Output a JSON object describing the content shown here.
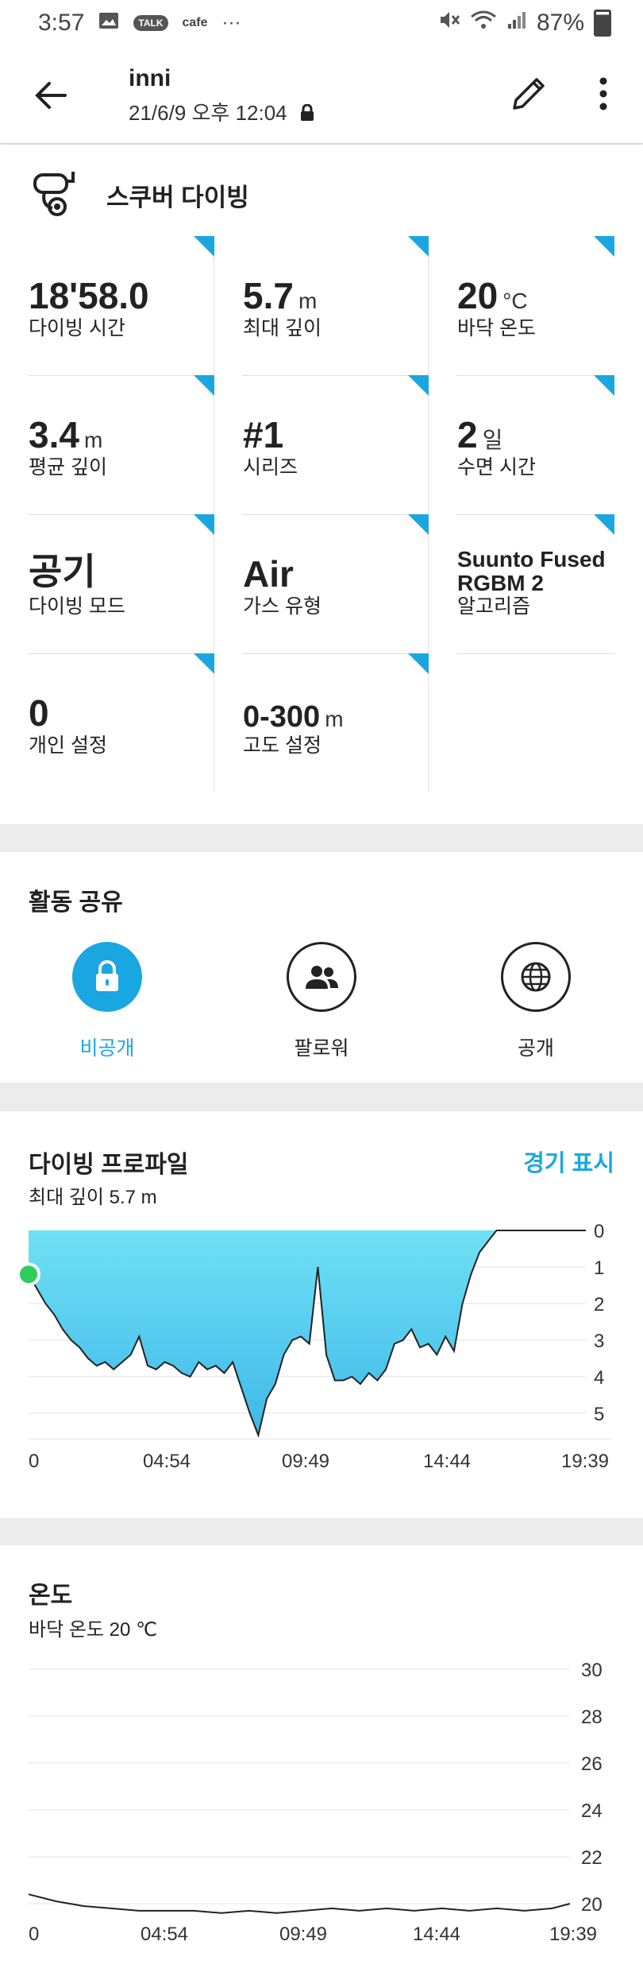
{
  "status": {
    "time": "3:57",
    "battery": "87%",
    "app_labels": [
      "TALK",
      "cafe"
    ],
    "more": "···"
  },
  "header": {
    "title": "inni",
    "subtitle": "21/6/9 오후 12:04"
  },
  "sport": {
    "label": "스쿠버 다이빙",
    "icon": "scuba-mask-icon"
  },
  "stats": [
    {
      "value": "18'58.0",
      "unit": "",
      "label": "다이빙 시간"
    },
    {
      "value": "5.7",
      "unit": "m",
      "label": "최대 깊이"
    },
    {
      "value": "20",
      "unit": "°C",
      "label": "바닥 온도"
    },
    {
      "value": "3.4",
      "unit": "m",
      "label": "평균 깊이"
    },
    {
      "value": "#1",
      "unit": "",
      "label": "시리즈"
    },
    {
      "value": "2",
      "unit": "일",
      "label": "수면 시간"
    },
    {
      "value": "공기",
      "unit": "",
      "label": "다이빙 모드"
    },
    {
      "value": "Air",
      "unit": "",
      "label": "가스 유형"
    },
    {
      "value": "Suunto Fused RGBM 2",
      "unit": "",
      "label": "알고리즘"
    },
    {
      "value": "0",
      "unit": "",
      "label": "개인 설정"
    },
    {
      "value": "0-300",
      "unit": "m",
      "label": "고도 설정"
    }
  ],
  "share": {
    "title": "활동 공유",
    "options": [
      {
        "label": "비공개",
        "icon": "lock-icon",
        "selected": true
      },
      {
        "label": "팔로워",
        "icon": "followers-icon",
        "selected": false
      },
      {
        "label": "공개",
        "icon": "globe-icon",
        "selected": false
      }
    ]
  },
  "colors": {
    "accent": "#1aa7e1",
    "marker": "#2ecc5a",
    "area_top": "#6fe1f5",
    "area_bottom": "#3fb8e8"
  },
  "profile": {
    "title": "다이빙 프로파일",
    "subtitle": "최대 깊이 5.7 m",
    "link": "경기 표시",
    "chart_data": {
      "type": "area",
      "x_ticks": [
        "0",
        "04:54",
        "09:49",
        "14:44",
        "19:39"
      ],
      "y_ticks": [
        "0",
        "1",
        "2",
        "3",
        "4",
        "5"
      ],
      "ylim": [
        0,
        5.7
      ],
      "y_inverted": true,
      "x_minutes": [
        0,
        0.3,
        0.6,
        0.9,
        1.2,
        1.5,
        1.8,
        2.1,
        2.4,
        2.7,
        3.0,
        3.3,
        3.6,
        3.9,
        4.2,
        4.5,
        4.8,
        5.1,
        5.4,
        5.7,
        6.0,
        6.3,
        6.6,
        6.9,
        7.2,
        7.5,
        7.8,
        8.1,
        8.4,
        8.7,
        9.0,
        9.3,
        9.6,
        9.9,
        10.2,
        10.5,
        10.8,
        11.1,
        11.4,
        11.7,
        12.0,
        12.3,
        12.6,
        12.9,
        13.2,
        13.5,
        13.8,
        14.1,
        14.4,
        14.7,
        15.0,
        15.3,
        15.6,
        15.9,
        16.2,
        16.5,
        16.8,
        17.1,
        17.4,
        17.7,
        18.0,
        18.3,
        18.6,
        18.9,
        19.2,
        19.65
      ],
      "depth_m": [
        1.2,
        1.6,
        2.0,
        2.3,
        2.7,
        3.0,
        3.2,
        3.5,
        3.7,
        3.6,
        3.8,
        3.6,
        3.4,
        2.9,
        3.7,
        3.8,
        3.6,
        3.7,
        3.9,
        4.0,
        3.6,
        3.8,
        3.7,
        3.9,
        3.6,
        4.3,
        5.0,
        5.6,
        4.6,
        4.2,
        3.4,
        3.0,
        2.9,
        3.1,
        1.0,
        3.4,
        4.1,
        4.1,
        4.0,
        4.2,
        3.9,
        4.1,
        3.8,
        3.1,
        3.0,
        2.7,
        3.2,
        3.1,
        3.4,
        2.9,
        3.3,
        2.0,
        1.2,
        0.6,
        0.3,
        0.0,
        0.0,
        0.0,
        0.0,
        0.0,
        0.0,
        0.0,
        0.0,
        0.0,
        0.0,
        0.0
      ]
    }
  },
  "temperature": {
    "title": "온도",
    "subtitle": "바닥 온도 20 ℃",
    "chart_data": {
      "type": "line",
      "x_ticks": [
        "0",
        "04:54",
        "09:49",
        "14:44",
        "19:39"
      ],
      "y_ticks": [
        "30",
        "28",
        "26",
        "24",
        "22",
        "20"
      ],
      "ylim": [
        19.6,
        30
      ],
      "x_minutes": [
        0,
        1,
        2,
        3,
        4,
        5,
        6,
        7,
        8,
        9,
        10,
        11,
        12,
        13,
        14,
        15,
        16,
        17,
        18,
        19,
        19.65
      ],
      "temp_c": [
        20.4,
        20.1,
        19.9,
        19.8,
        19.7,
        19.7,
        19.7,
        19.6,
        19.7,
        19.6,
        19.7,
        19.8,
        19.7,
        19.8,
        19.7,
        19.8,
        19.7,
        19.8,
        19.7,
        19.8,
        20.0
      ]
    }
  }
}
